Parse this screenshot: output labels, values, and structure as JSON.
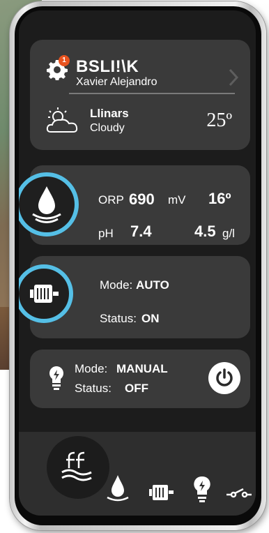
{
  "header": {
    "notification_count": "1",
    "brand": "BSLI!\\K",
    "user_name": "Xavier Alejandro",
    "city": "Llinars",
    "condition": "Cloudy",
    "temperature": "25º",
    "icons": [
      "gear-icon",
      "chevron-right-icon",
      "cloud-sun-icon"
    ]
  },
  "water": {
    "orp_label": "ORP",
    "orp_value": "690",
    "orp_unit": "mV",
    "water_temp": "16º",
    "ph_label": "pH",
    "ph_value": "7.4",
    "salt_value": "4.5",
    "salt_unit": "g/l",
    "icon": "water-drop-icon"
  },
  "pump": {
    "mode_label": "Mode:",
    "mode_value": "AUTO",
    "status_label": "Status:",
    "status_value": "ON",
    "icon": "motor-icon"
  },
  "light": {
    "mode_label": "Mode:",
    "mode_value": "MANUAL",
    "status_label": "Status:",
    "status_value": "OFF",
    "icon": "lightbulb-icon"
  },
  "nav": {
    "items": [
      "water-drop-icon",
      "motor-icon",
      "lightbulb-icon",
      "switch-icon"
    ],
    "logo": "ff-logo-icon"
  },
  "colors": {
    "accent": "#55bfe6",
    "badge": "#e8531f",
    "card": "#3a3a3a",
    "screen": "#1c1c1c"
  }
}
